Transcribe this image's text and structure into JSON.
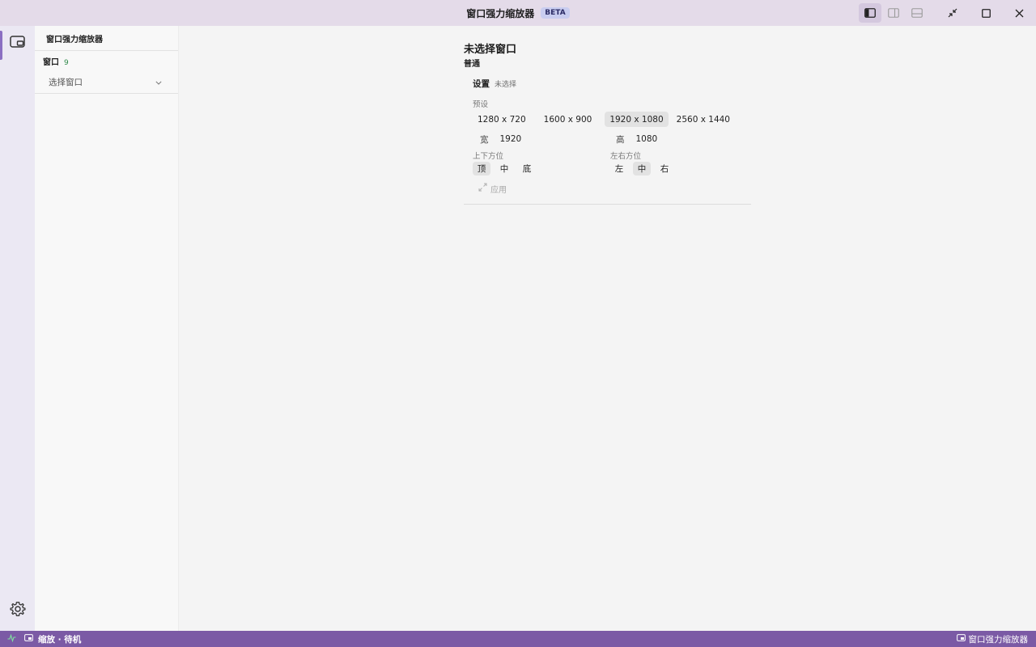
{
  "titlebar": {
    "title": "窗口强力缩放器",
    "badge": "BETA",
    "controls": [
      "toggle-left-panel-icon",
      "toggle-right-panel-icon",
      "toggle-bottom-panel-icon",
      "collapse-icon",
      "maximize-icon",
      "close-icon"
    ]
  },
  "activity": {
    "items": [
      {
        "icon": "window-icon",
        "active": true
      }
    ],
    "settings_icon": "gear-icon"
  },
  "sidebar": {
    "title": "窗口强力缩放器",
    "section_label": "窗口",
    "section_count": "9",
    "select_placeholder": "选择窗口"
  },
  "main": {
    "title": "未选择窗口",
    "subtitle": "普通",
    "card": {
      "heading": "设置",
      "heading_sub": "未选择",
      "presets_label": "预设",
      "presets": [
        "1280 x 720",
        "1600 x 900",
        "1920 x 1080",
        "2560 x 1440"
      ],
      "selected_preset": "1920 x 1080",
      "width_label": "宽",
      "width_value": "1920",
      "height_label": "高",
      "height_value": "1080",
      "vertical_label": "上下方位",
      "vertical_options": [
        "顶",
        "中",
        "底"
      ],
      "vertical_selected": "顶",
      "horizontal_label": "左右方位",
      "horizontal_options": [
        "左",
        "中",
        "右"
      ],
      "horizontal_selected": "中",
      "apply_label": "应用"
    }
  },
  "statusbar": {
    "left_text": "缩放 · 待机",
    "right_text": "窗口强力缩放器",
    "color": "#7b5aa5"
  }
}
